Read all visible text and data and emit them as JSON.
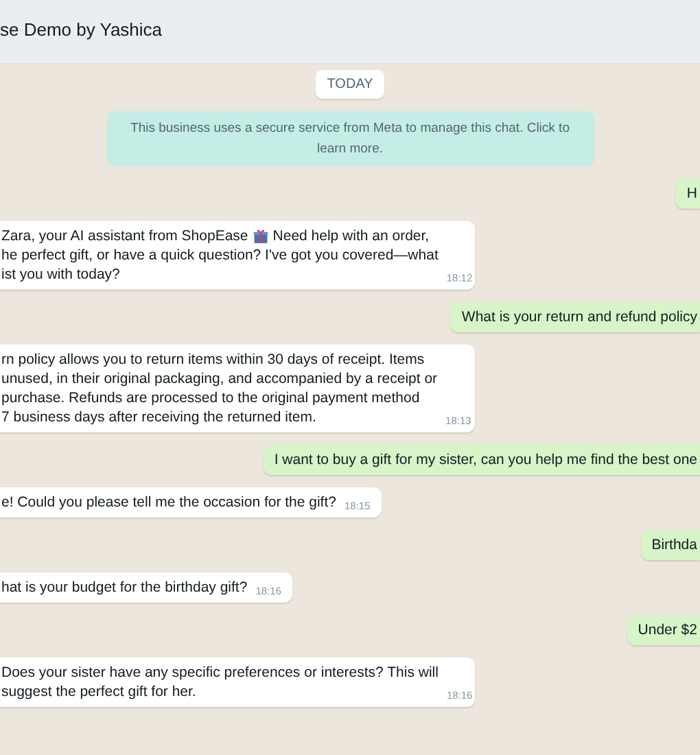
{
  "header": {
    "title": "se Demo by Yashica"
  },
  "date_label": "TODAY",
  "notice": "This business uses a secure service from Meta to manage this chat. Click to learn more.",
  "messages": [
    {
      "kind": "outgoing",
      "text": "H"
    },
    {
      "kind": "incoming",
      "lines": [
        {
          "text": "Zara, your AI assistant from ShopEase",
          "text_after": "Need help with an order,"
        },
        {
          "text": "he perfect gift, or have a quick question? I've got you covered—what"
        },
        {
          "text": "ist you with today?"
        }
      ],
      "time": "18:12"
    },
    {
      "kind": "outgoing",
      "text": "What is your return and refund policy"
    },
    {
      "kind": "incoming",
      "lines": [
        {
          "text": "rn policy allows you to return items within 30 days of receipt. Items"
        },
        {
          "text": "unused, in their original packaging, and accompanied by a receipt or"
        },
        {
          "text": "purchase. Refunds are processed to the original payment method"
        },
        {
          "text": "7 business days after receiving the returned item."
        }
      ],
      "time": "18:13"
    },
    {
      "kind": "outgoing",
      "text": "I want to buy a gift for my sister, can you help me find the best one"
    },
    {
      "kind": "incoming",
      "lines": [
        {
          "text": "e! Could you please tell me the occasion for the gift?"
        }
      ],
      "time": "18:15"
    },
    {
      "kind": "outgoing",
      "text": "Birthda"
    },
    {
      "kind": "incoming",
      "lines": [
        {
          "text": "hat is your budget for the birthday gift?"
        }
      ],
      "time": "18:16"
    },
    {
      "kind": "outgoing",
      "text": "Under $2"
    },
    {
      "kind": "incoming",
      "lines": [
        {
          "text": "Does your sister have any specific preferences or interests? This will"
        },
        {
          "text": "suggest the perfect gift for her."
        }
      ],
      "time": "18:16"
    }
  ]
}
